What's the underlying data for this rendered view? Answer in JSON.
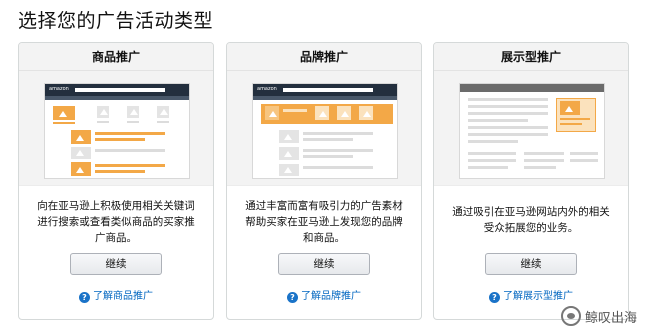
{
  "page": {
    "title": "选择您的广告活动类型"
  },
  "cards": [
    {
      "title": "商品推广",
      "description": "向在亚马逊上积极使用相关关键词进行搜索或查看类似商品的买家推广商品。",
      "button_label": "继续",
      "link_label": "了解商品推广",
      "mock_logo": "amazon"
    },
    {
      "title": "品牌推广",
      "description": "通过丰富而富有吸引力的广告素材帮助买家在亚马逊上发现您的品牌和商品。",
      "button_label": "继续",
      "link_label": "了解品牌推广",
      "mock_logo": "amazon"
    },
    {
      "title": "展示型推广",
      "description": "通过吸引在亚马逊网站内外的相关受众拓展您的业务。",
      "button_label": "继续",
      "link_label": "了解展示型推广"
    }
  ],
  "watermark": {
    "text": "鲸叹出海",
    "icon": "wechat-logo-icon"
  },
  "colors": {
    "accent": "#f3a847",
    "link": "#0066c0",
    "header_bg": "#f3f3f3",
    "nav_dark": "#232f3e"
  },
  "help_icon": "question-circle-icon"
}
